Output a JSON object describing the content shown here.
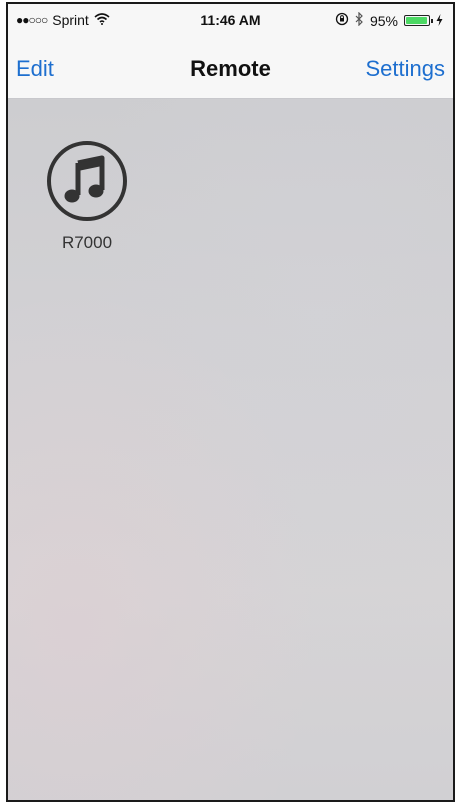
{
  "status_bar": {
    "signal": "●●○○○",
    "carrier": "Sprint",
    "wifi_icon": "wifi-icon",
    "time": "11:46 AM",
    "orientation_lock_icon": "orientation-lock-icon",
    "bluetooth_icon": "bluetooth-icon",
    "battery_percent": "95%",
    "battery_level": 0.95,
    "battery_color": "#4cd964"
  },
  "nav": {
    "left_label": "Edit",
    "title": "Remote",
    "right_label": "Settings",
    "accent_color": "#1e6fcf"
  },
  "devices": [
    {
      "label": "R7000",
      "icon": "music-note-icon"
    }
  ]
}
